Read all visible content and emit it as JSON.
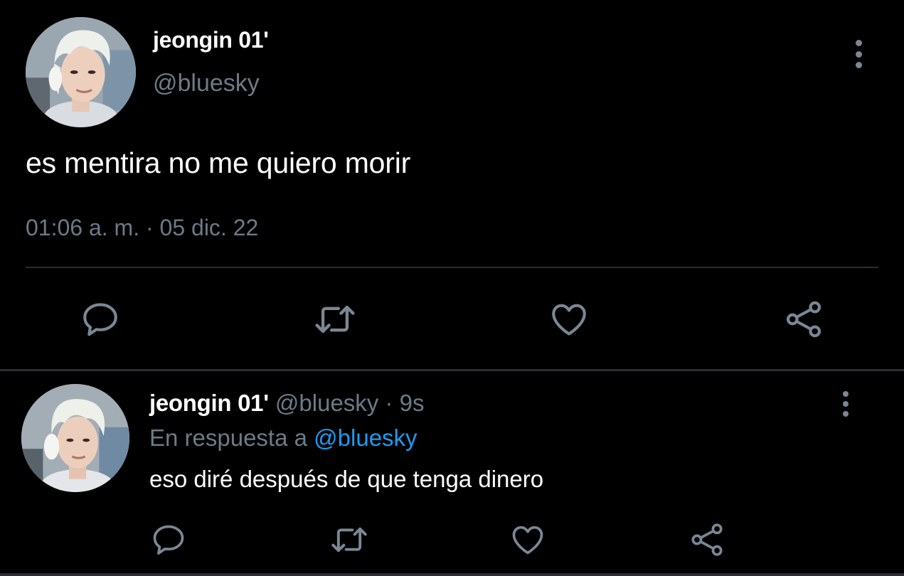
{
  "main_tweet": {
    "display_name": "jeongin 01'",
    "handle": "@bluesky",
    "text": "es mentira no me quiero morir",
    "timestamp": "01:06 a. m. · 05 dic. 22",
    "actions": [
      "reply-icon",
      "retweet-icon",
      "like-icon",
      "share-icon"
    ],
    "more_icon": "more-vertical-icon"
  },
  "reply_tweet": {
    "display_name": "jeongin 01'",
    "handle": "@bluesky",
    "separator": "·",
    "age": "9s",
    "reply_to_prefix": "En respuesta a",
    "reply_to_handle": "@bluesky",
    "text": "eso diré después de que tenga dinero",
    "actions": [
      "reply-icon",
      "retweet-icon",
      "like-icon",
      "share-icon"
    ],
    "more_icon": "more-vertical-icon"
  },
  "colors": {
    "background": "#000000",
    "primary_text": "#ffffff",
    "secondary_text": "#6e7a86",
    "icon": "#7b8794",
    "link": "#1d9bf0",
    "divider": "#2a2e33"
  }
}
